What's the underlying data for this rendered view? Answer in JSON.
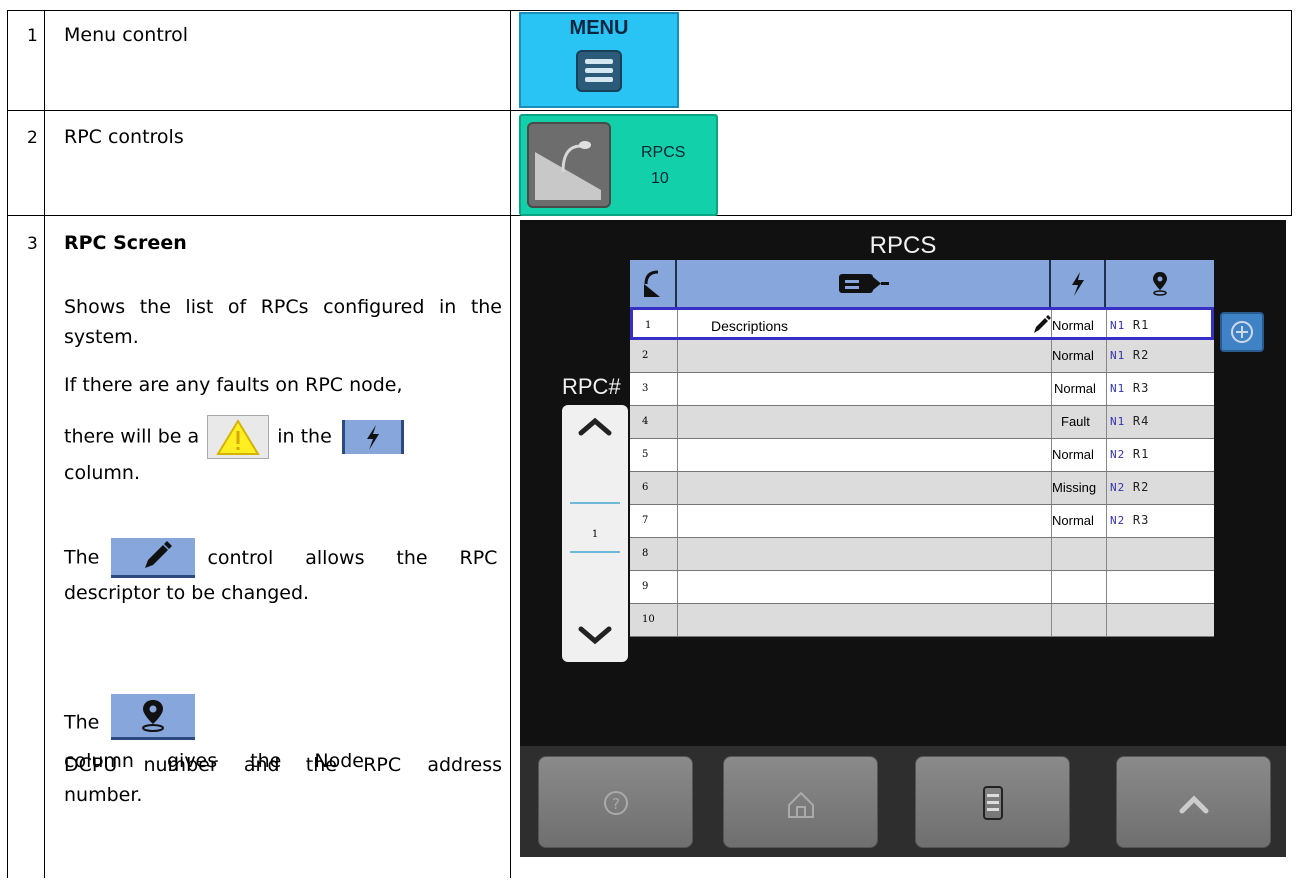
{
  "rows": [
    {
      "num": "1",
      "desc": "Menu control"
    },
    {
      "num": "2",
      "desc": "RPC controls"
    },
    {
      "num": "3",
      "title": "RPC Screen",
      "p1": "Shows the list of RPCs configured in the system.",
      "p2a": "If there are any faults on RPC node,",
      "p2b": "there will be a",
      "p2c": "in the",
      "p2d": "column.",
      "p3a": "The",
      "p3b": "control allows the RPC",
      "p3c": "descriptor to be changed.",
      "p4a": "The",
      "p4b": "column gives the Node",
      "p4c": "DCPU number and the RPC address",
      "p4d": "number."
    }
  ],
  "menu_button": {
    "label": "MENU",
    "icon": "hamburger-icon",
    "color": "#29c4f4"
  },
  "rpc_button": {
    "line1": "RPCS",
    "line2": "10",
    "icon": "microphone-icon",
    "color": "#11d0aa"
  },
  "screen": {
    "title": "RPCS",
    "side_label": "RPC#",
    "page": "1",
    "header_icons": [
      "microphone-icon",
      "tag-icon",
      "lightning-icon",
      "location-pin-icon"
    ],
    "table": [
      {
        "num": "1",
        "desc": "Descriptions",
        "status": "Normal",
        "node": "N1",
        "rpc": "R1",
        "selected": true
      },
      {
        "num": "2",
        "desc": "",
        "status": "Normal",
        "node": "N1",
        "rpc": "R2"
      },
      {
        "num": "3",
        "desc": "",
        "status": "Normal",
        "node": "N1",
        "rpc": "R3"
      },
      {
        "num": "4",
        "desc": "",
        "status": "Fault",
        "node": "N1",
        "rpc": "R4"
      },
      {
        "num": "5",
        "desc": "",
        "status": "Normal",
        "node": "N2",
        "rpc": "R1"
      },
      {
        "num": "6",
        "desc": "",
        "status": "Missing",
        "node": "N2",
        "rpc": "R2"
      },
      {
        "num": "7",
        "desc": "",
        "status": "Normal",
        "node": "N2",
        "rpc": "R3"
      },
      {
        "num": "8",
        "desc": "",
        "status": "",
        "node": "",
        "rpc": ""
      },
      {
        "num": "9",
        "desc": "",
        "status": "",
        "node": "",
        "rpc": ""
      },
      {
        "num": "10",
        "desc": "",
        "status": "",
        "node": "",
        "rpc": ""
      }
    ],
    "bottom_buttons": [
      "help-icon",
      "home-icon",
      "menu-icon",
      "up-arrow-icon"
    ]
  }
}
